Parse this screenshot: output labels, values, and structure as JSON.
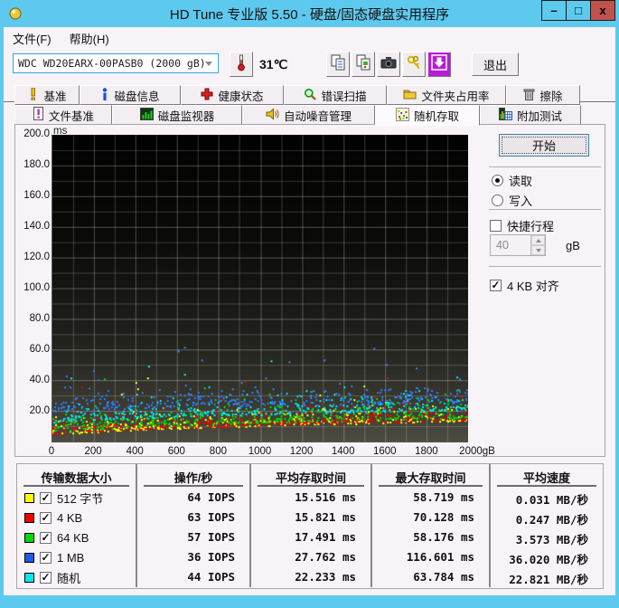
{
  "window": {
    "title": "HD Tune 专业版 5.50 - 硬盘/固态硬盘实用程序",
    "minimize_glyph": "–",
    "maximize_glyph": "□",
    "close_glyph": "x"
  },
  "menu": {
    "items": [
      "文件(F)",
      "帮助(H)"
    ]
  },
  "toolbar": {
    "drive_select_value": "WDC WD20EARX-00PASB0  (2000 gB)",
    "temperature": "31℃",
    "exit_label": "退出",
    "buttons": [
      "thermometer-icon",
      "copy-text-icon",
      "copy-image-icon",
      "camera-icon",
      "keys-icon",
      "update-icon"
    ]
  },
  "tabs": {
    "row1": [
      {
        "label": "基准",
        "icon": "exclaim-icon",
        "width": 72
      },
      {
        "label": "磁盘信息",
        "icon": "info-icon",
        "width": 112
      },
      {
        "label": "健康状态",
        "icon": "health-icon",
        "width": 114
      },
      {
        "label": "错误扫描",
        "icon": "scan-icon",
        "width": 114
      },
      {
        "label": "文件夹占用率",
        "icon": "folder-icon",
        "width": 132
      },
      {
        "label": "擦除",
        "icon": "erase-icon",
        "width": 82
      }
    ],
    "row2": [
      {
        "label": "文件基准",
        "icon": "file-bench-icon",
        "width": 108
      },
      {
        "label": "磁盘监视器",
        "icon": "disk-monitor-icon",
        "width": 144
      },
      {
        "label": "自动噪音管理",
        "icon": "noise-icon",
        "width": 147
      },
      {
        "label": "随机存取",
        "icon": "random-access-icon",
        "width": 116,
        "active": true
      },
      {
        "label": "附加测试",
        "icon": "extra-tests-icon",
        "width": 112
      }
    ],
    "active": "随机存取"
  },
  "controls": {
    "start_label": "开始",
    "read_label": "读取",
    "write_label": "写入",
    "read_selected": true,
    "short_stroke_label": "快捷行程",
    "short_stroke_checked": false,
    "capacity_value": "40",
    "capacity_unit": "gB",
    "align_label": "4 KB 对齐",
    "align_checked": true
  },
  "chart_data": {
    "type": "scatter",
    "title": "随机存取时间散点图",
    "y_unit": "ms",
    "x_unit": "gB",
    "xlim": [
      0,
      2000
    ],
    "ylim": [
      0,
      200
    ],
    "x_tick_values": [
      0,
      200,
      400,
      600,
      800,
      1000,
      1200,
      1400,
      1600,
      1800,
      2000
    ],
    "x_tick_labels": [
      "0",
      "200",
      "400",
      "600",
      "800",
      "1000",
      "1200",
      "1400",
      "1600",
      "1800",
      "2000gB"
    ],
    "y_tick_values": [
      200,
      180,
      160,
      140,
      120,
      100,
      80,
      60,
      40,
      20
    ],
    "grid": {
      "x_minor_step": 100,
      "y_minor_step": 10,
      "y_major_step": 20
    },
    "series": [
      {
        "name": "512 字节",
        "color": "#ffff00",
        "iops": 64,
        "avg_ms": 15.516,
        "max_ms": 58.719,
        "speed_mbs": 0.031,
        "scatter": {
          "seed": 11,
          "count": 380,
          "base_start": 3.5,
          "base_end": 13,
          "mean": 3.5,
          "band_cap": 17,
          "outlier_rate": 0.008,
          "outlier_max": 45
        }
      },
      {
        "name": "4 KB",
        "color": "#f00000",
        "iops": 63,
        "avg_ms": 15.821,
        "max_ms": 70.128,
        "speed_mbs": 0.247,
        "scatter": {
          "seed": 22,
          "count": 380,
          "base_start": 4,
          "base_end": 13.5,
          "mean": 4,
          "band_cap": 18,
          "outlier_rate": 0.01,
          "outlier_max": 58
        }
      },
      {
        "name": "64 KB",
        "color": "#00d800",
        "iops": 57,
        "avg_ms": 17.491,
        "max_ms": 58.176,
        "speed_mbs": 3.573,
        "scatter": {
          "seed": 33,
          "count": 380,
          "base_start": 5,
          "base_end": 15,
          "mean": 4.5,
          "band_cap": 20,
          "outlier_rate": 0.01,
          "outlier_max": 58
        }
      },
      {
        "name": "随机",
        "color": "#00e8e8",
        "iops": 44,
        "avg_ms": 22.233,
        "max_ms": 63.784,
        "speed_mbs": 22.821,
        "scatter": {
          "seed": 55,
          "count": 360,
          "base_start": 12,
          "base_end": 20,
          "mean": 4,
          "band_cap": 18,
          "outlier_rate": 0.02,
          "outlier_max": 58
        }
      },
      {
        "name": "1 MB",
        "color": "#2e7cf6",
        "iops": 36,
        "avg_ms": 27.762,
        "max_ms": 116.601,
        "speed_mbs": 36.02,
        "scatter": {
          "seed": 44,
          "count": 360,
          "base_start": 19,
          "base_end": 25,
          "mean": 5,
          "band_cap": 16,
          "outlier_rate": 0.05,
          "outlier_max": 63
        }
      }
    ]
  },
  "stats_table": {
    "headers": [
      "传输数据大小",
      "操作/秒",
      "平均存取时间",
      "最大存取时间",
      "平均速度"
    ],
    "rows": [
      {
        "color": "#ffff00",
        "label": "512 字节",
        "iops": "64 IOPS",
        "avg": "15.516 ms",
        "max": "58.719 ms",
        "speed": "0.031 MB/秒",
        "checked": true
      },
      {
        "color": "#f00000",
        "label": "4 KB",
        "iops": "63 IOPS",
        "avg": "15.821 ms",
        "max": "70.128 ms",
        "speed": "0.247 MB/秒",
        "checked": true
      },
      {
        "color": "#00d800",
        "label": "64 KB",
        "iops": "57 IOPS",
        "avg": "17.491 ms",
        "max": "58.176 ms",
        "speed": "3.573 MB/秒",
        "checked": true
      },
      {
        "color": "#1e5ae6",
        "label": "1 MB",
        "iops": "36 IOPS",
        "avg": "27.762 ms",
        "max": "116.601 ms",
        "speed": "36.020 MB/秒",
        "checked": true
      },
      {
        "color": "#00e8e8",
        "label": "随机",
        "iops": "44 IOPS",
        "avg": "22.233 ms",
        "max": "63.784 ms",
        "speed": "22.821 MB/秒",
        "checked": true
      }
    ]
  }
}
